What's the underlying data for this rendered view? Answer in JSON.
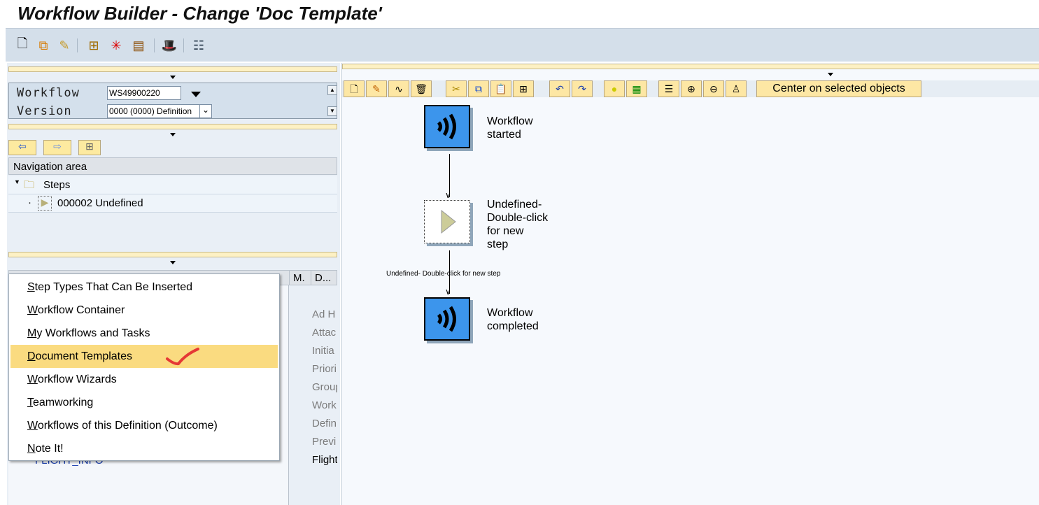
{
  "window": {
    "title": "Workflow Builder - Change 'Doc Template'"
  },
  "toolbar": {
    "icons": [
      "new-document-icon",
      "copy-icon",
      "edit-pencil-icon",
      "structure-icon",
      "magic-wand-icon",
      "film-icon",
      "hat-icon",
      "list-icon"
    ]
  },
  "workflow_box": {
    "workflow_label": "Workflow",
    "workflow_value": "WS49900220",
    "version_label": "Version",
    "version_value": "0000 (0000) Definition"
  },
  "navigation": {
    "header": "Navigation area",
    "root": "Steps",
    "items": [
      "000002 Undefined"
    ]
  },
  "lower_table": {
    "columns": [
      "M.",
      "D..."
    ],
    "right_cells": [
      "Ad H",
      "Attac",
      "Initia",
      "Priori",
      "Group",
      "Work",
      "Defin",
      "Previ",
      "Flight"
    ],
    "hidden_item": "FLIGHT_INFO"
  },
  "menu": {
    "items": [
      {
        "label": "Step Types That Can Be Inserted",
        "accel": "S",
        "rest": "tep Types That Can Be Inserted"
      },
      {
        "label": "Workflow Container",
        "accel": "W",
        "rest": "orkflow Container"
      },
      {
        "label": "My Workflows and Tasks",
        "accel": "M",
        "rest": "y Workflows and Tasks"
      },
      {
        "label": "Document Templates",
        "accel": "D",
        "rest": "ocument Templates",
        "selected": true
      },
      {
        "label": "Workflow Wizards",
        "accel": "W",
        "rest": "orkflow Wizards"
      },
      {
        "label": "Teamworking",
        "accel": "T",
        "rest": "eamworking"
      },
      {
        "label": "Workflows of this Definition (Outcome)",
        "accel": "W",
        "rest": "orkflows of this Definition (Outcome)"
      },
      {
        "label": "Note It!",
        "accel": "N",
        "rest": "ote It!"
      }
    ],
    "annotation_color": "#e53935"
  },
  "graphic_toolbar": {
    "center_button": "Center on selected objects"
  },
  "diagram": {
    "nodes": [
      {
        "type": "event",
        "label_line1": "Workflow",
        "label_line2": "started"
      },
      {
        "type": "undefined",
        "lines": [
          "Undefined-",
          "Double-click",
          "for new",
          "step"
        ]
      },
      {
        "type": "event",
        "label_line1": "Workflow",
        "label_line2": "completed"
      }
    ],
    "edge_label": "Undefined- Double-click for new step"
  },
  "colors": {
    "accent_menu": "#fadb80",
    "node_blue": "#3c95ec"
  }
}
